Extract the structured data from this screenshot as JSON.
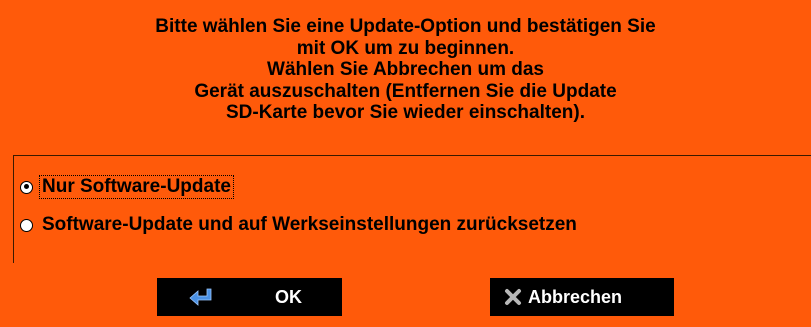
{
  "dialog": {
    "message_lines": [
      "Bitte wählen Sie eine Update-Option und bestätigen Sie",
      "mit OK um zu beginnen.",
      "Wählen Sie Abbrechen um das",
      "Gerät auszuschalten (Entfernen Sie die Update",
      "SD-Karte bevor Sie wieder einschalten)."
    ],
    "options": [
      {
        "label": "Nur Software-Update",
        "selected": true,
        "focused": true
      },
      {
        "label": "Software-Update und auf Werkseinstellungen zurücksetzen",
        "selected": false,
        "focused": false
      }
    ],
    "buttons": {
      "ok_label": "OK",
      "ok_icon": "enter-arrow-icon",
      "cancel_label": "Abbrechen",
      "cancel_icon": "close-x-icon"
    }
  },
  "colors": {
    "background": "#ff5a0a",
    "button_background": "#000000",
    "button_text": "#ffffff",
    "ok_icon": "#4a90e2",
    "cancel_icon": "#b0b0b0"
  }
}
